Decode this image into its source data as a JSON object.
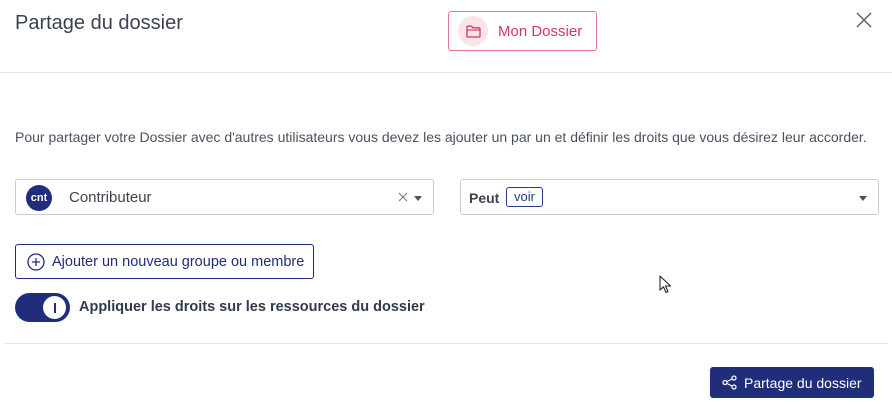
{
  "dialog": {
    "title": "Partage du dossier",
    "folder_chip_label": "Mon Dossier",
    "close_icon": "close-icon"
  },
  "description": "Pour partager votre Dossier avec d'autres utilisateurs vous devez les ajouter un par un et définir les droits que vous désirez leur accorder.",
  "group_select": {
    "avatar_text": "cnt",
    "value": "Contributeur"
  },
  "rights_select": {
    "prefix": "Peut",
    "badge": "voir"
  },
  "add_button_label": "Ajouter un nouveau groupe ou membre",
  "apply_toggle": {
    "on": true,
    "label": "Appliquer les droits sur les ressources du dossier"
  },
  "share_button_label": "Partage du dossier",
  "colors": {
    "primary": "#1f2d7a",
    "accent_pink": "#d6375f",
    "border": "#c9cdd4"
  }
}
